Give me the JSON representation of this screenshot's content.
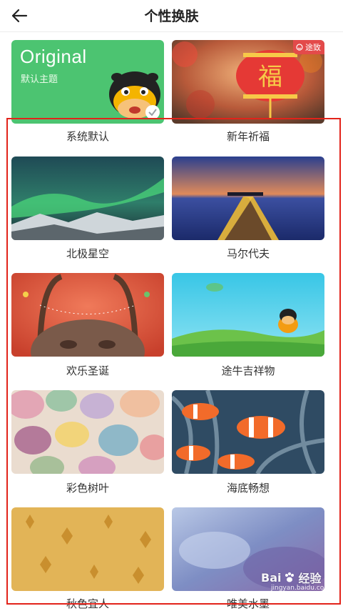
{
  "header": {
    "title": "个性换肤"
  },
  "themes": [
    {
      "name": "系统默认",
      "selected": true
    },
    {
      "name": "新年祈福",
      "tag": "途致"
    },
    {
      "name": "北极星空"
    },
    {
      "name": "马尔代夫"
    },
    {
      "name": "欢乐圣诞"
    },
    {
      "name": "途牛吉祥物"
    },
    {
      "name": "彩色树叶"
    },
    {
      "name": "海底畅想"
    },
    {
      "name": "秋色宜人"
    },
    {
      "name": "唯美水墨"
    }
  ],
  "default_card": {
    "title": "Original",
    "subtitle": "默认主题"
  },
  "lantern_char": "福",
  "watermark": {
    "brand": "Bai",
    "suffix": "经验",
    "sub": "jingyan.baidu.com"
  },
  "colors": {
    "accent": "#e2231a",
    "default_green": "#4cc471"
  }
}
